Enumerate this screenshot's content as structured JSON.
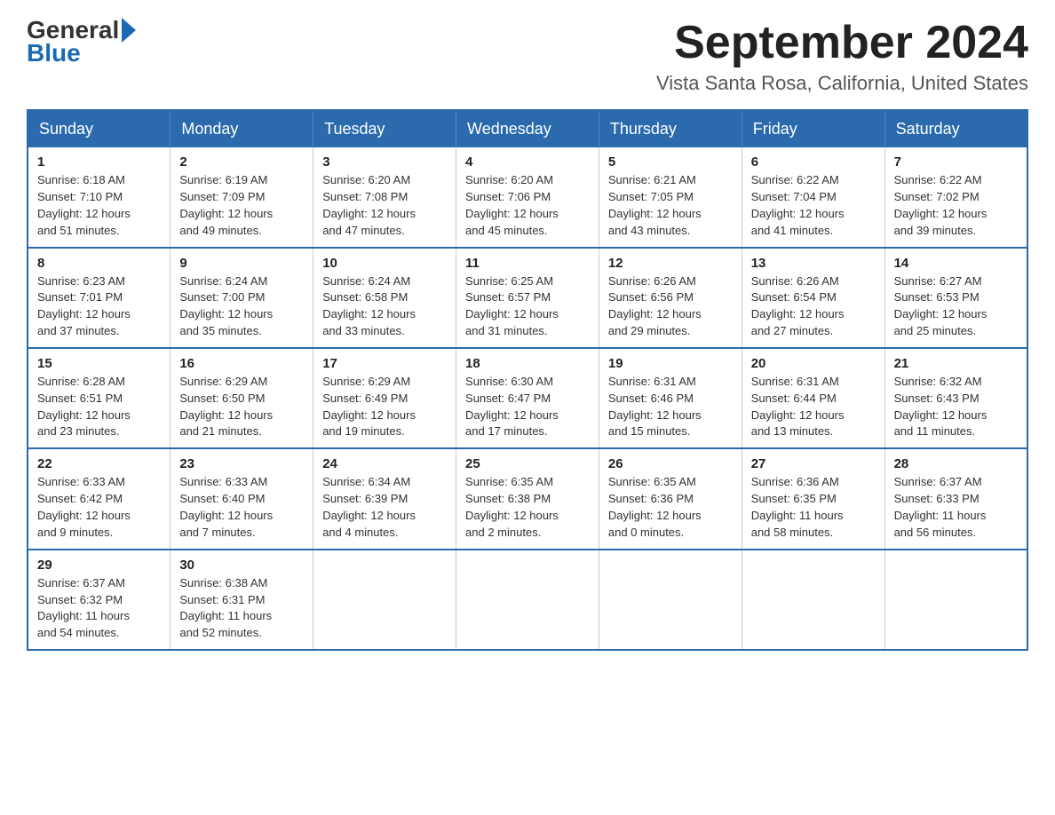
{
  "logo": {
    "general": "General",
    "blue": "Blue",
    "arrow": "▶"
  },
  "header": {
    "month_year": "September 2024",
    "location": "Vista Santa Rosa, California, United States"
  },
  "weekdays": [
    "Sunday",
    "Monday",
    "Tuesday",
    "Wednesday",
    "Thursday",
    "Friday",
    "Saturday"
  ],
  "weeks": [
    [
      {
        "day": "1",
        "sunrise": "6:18 AM",
        "sunset": "7:10 PM",
        "daylight": "12 hours and 51 minutes."
      },
      {
        "day": "2",
        "sunrise": "6:19 AM",
        "sunset": "7:09 PM",
        "daylight": "12 hours and 49 minutes."
      },
      {
        "day": "3",
        "sunrise": "6:20 AM",
        "sunset": "7:08 PM",
        "daylight": "12 hours and 47 minutes."
      },
      {
        "day": "4",
        "sunrise": "6:20 AM",
        "sunset": "7:06 PM",
        "daylight": "12 hours and 45 minutes."
      },
      {
        "day": "5",
        "sunrise": "6:21 AM",
        "sunset": "7:05 PM",
        "daylight": "12 hours and 43 minutes."
      },
      {
        "day": "6",
        "sunrise": "6:22 AM",
        "sunset": "7:04 PM",
        "daylight": "12 hours and 41 minutes."
      },
      {
        "day": "7",
        "sunrise": "6:22 AM",
        "sunset": "7:02 PM",
        "daylight": "12 hours and 39 minutes."
      }
    ],
    [
      {
        "day": "8",
        "sunrise": "6:23 AM",
        "sunset": "7:01 PM",
        "daylight": "12 hours and 37 minutes."
      },
      {
        "day": "9",
        "sunrise": "6:24 AM",
        "sunset": "7:00 PM",
        "daylight": "12 hours and 35 minutes."
      },
      {
        "day": "10",
        "sunrise": "6:24 AM",
        "sunset": "6:58 PM",
        "daylight": "12 hours and 33 minutes."
      },
      {
        "day": "11",
        "sunrise": "6:25 AM",
        "sunset": "6:57 PM",
        "daylight": "12 hours and 31 minutes."
      },
      {
        "day": "12",
        "sunrise": "6:26 AM",
        "sunset": "6:56 PM",
        "daylight": "12 hours and 29 minutes."
      },
      {
        "day": "13",
        "sunrise": "6:26 AM",
        "sunset": "6:54 PM",
        "daylight": "12 hours and 27 minutes."
      },
      {
        "day": "14",
        "sunrise": "6:27 AM",
        "sunset": "6:53 PM",
        "daylight": "12 hours and 25 minutes."
      }
    ],
    [
      {
        "day": "15",
        "sunrise": "6:28 AM",
        "sunset": "6:51 PM",
        "daylight": "12 hours and 23 minutes."
      },
      {
        "day": "16",
        "sunrise": "6:29 AM",
        "sunset": "6:50 PM",
        "daylight": "12 hours and 21 minutes."
      },
      {
        "day": "17",
        "sunrise": "6:29 AM",
        "sunset": "6:49 PM",
        "daylight": "12 hours and 19 minutes."
      },
      {
        "day": "18",
        "sunrise": "6:30 AM",
        "sunset": "6:47 PM",
        "daylight": "12 hours and 17 minutes."
      },
      {
        "day": "19",
        "sunrise": "6:31 AM",
        "sunset": "6:46 PM",
        "daylight": "12 hours and 15 minutes."
      },
      {
        "day": "20",
        "sunrise": "6:31 AM",
        "sunset": "6:44 PM",
        "daylight": "12 hours and 13 minutes."
      },
      {
        "day": "21",
        "sunrise": "6:32 AM",
        "sunset": "6:43 PM",
        "daylight": "12 hours and 11 minutes."
      }
    ],
    [
      {
        "day": "22",
        "sunrise": "6:33 AM",
        "sunset": "6:42 PM",
        "daylight": "12 hours and 9 minutes."
      },
      {
        "day": "23",
        "sunrise": "6:33 AM",
        "sunset": "6:40 PM",
        "daylight": "12 hours and 7 minutes."
      },
      {
        "day": "24",
        "sunrise": "6:34 AM",
        "sunset": "6:39 PM",
        "daylight": "12 hours and 4 minutes."
      },
      {
        "day": "25",
        "sunrise": "6:35 AM",
        "sunset": "6:38 PM",
        "daylight": "12 hours and 2 minutes."
      },
      {
        "day": "26",
        "sunrise": "6:35 AM",
        "sunset": "6:36 PM",
        "daylight": "12 hours and 0 minutes."
      },
      {
        "day": "27",
        "sunrise": "6:36 AM",
        "sunset": "6:35 PM",
        "daylight": "11 hours and 58 minutes."
      },
      {
        "day": "28",
        "sunrise": "6:37 AM",
        "sunset": "6:33 PM",
        "daylight": "11 hours and 56 minutes."
      }
    ],
    [
      {
        "day": "29",
        "sunrise": "6:37 AM",
        "sunset": "6:32 PM",
        "daylight": "11 hours and 54 minutes."
      },
      {
        "day": "30",
        "sunrise": "6:38 AM",
        "sunset": "6:31 PM",
        "daylight": "11 hours and 52 minutes."
      },
      null,
      null,
      null,
      null,
      null
    ]
  ],
  "labels": {
    "sunrise": "Sunrise: ",
    "sunset": "Sunset: ",
    "daylight": "Daylight: "
  }
}
